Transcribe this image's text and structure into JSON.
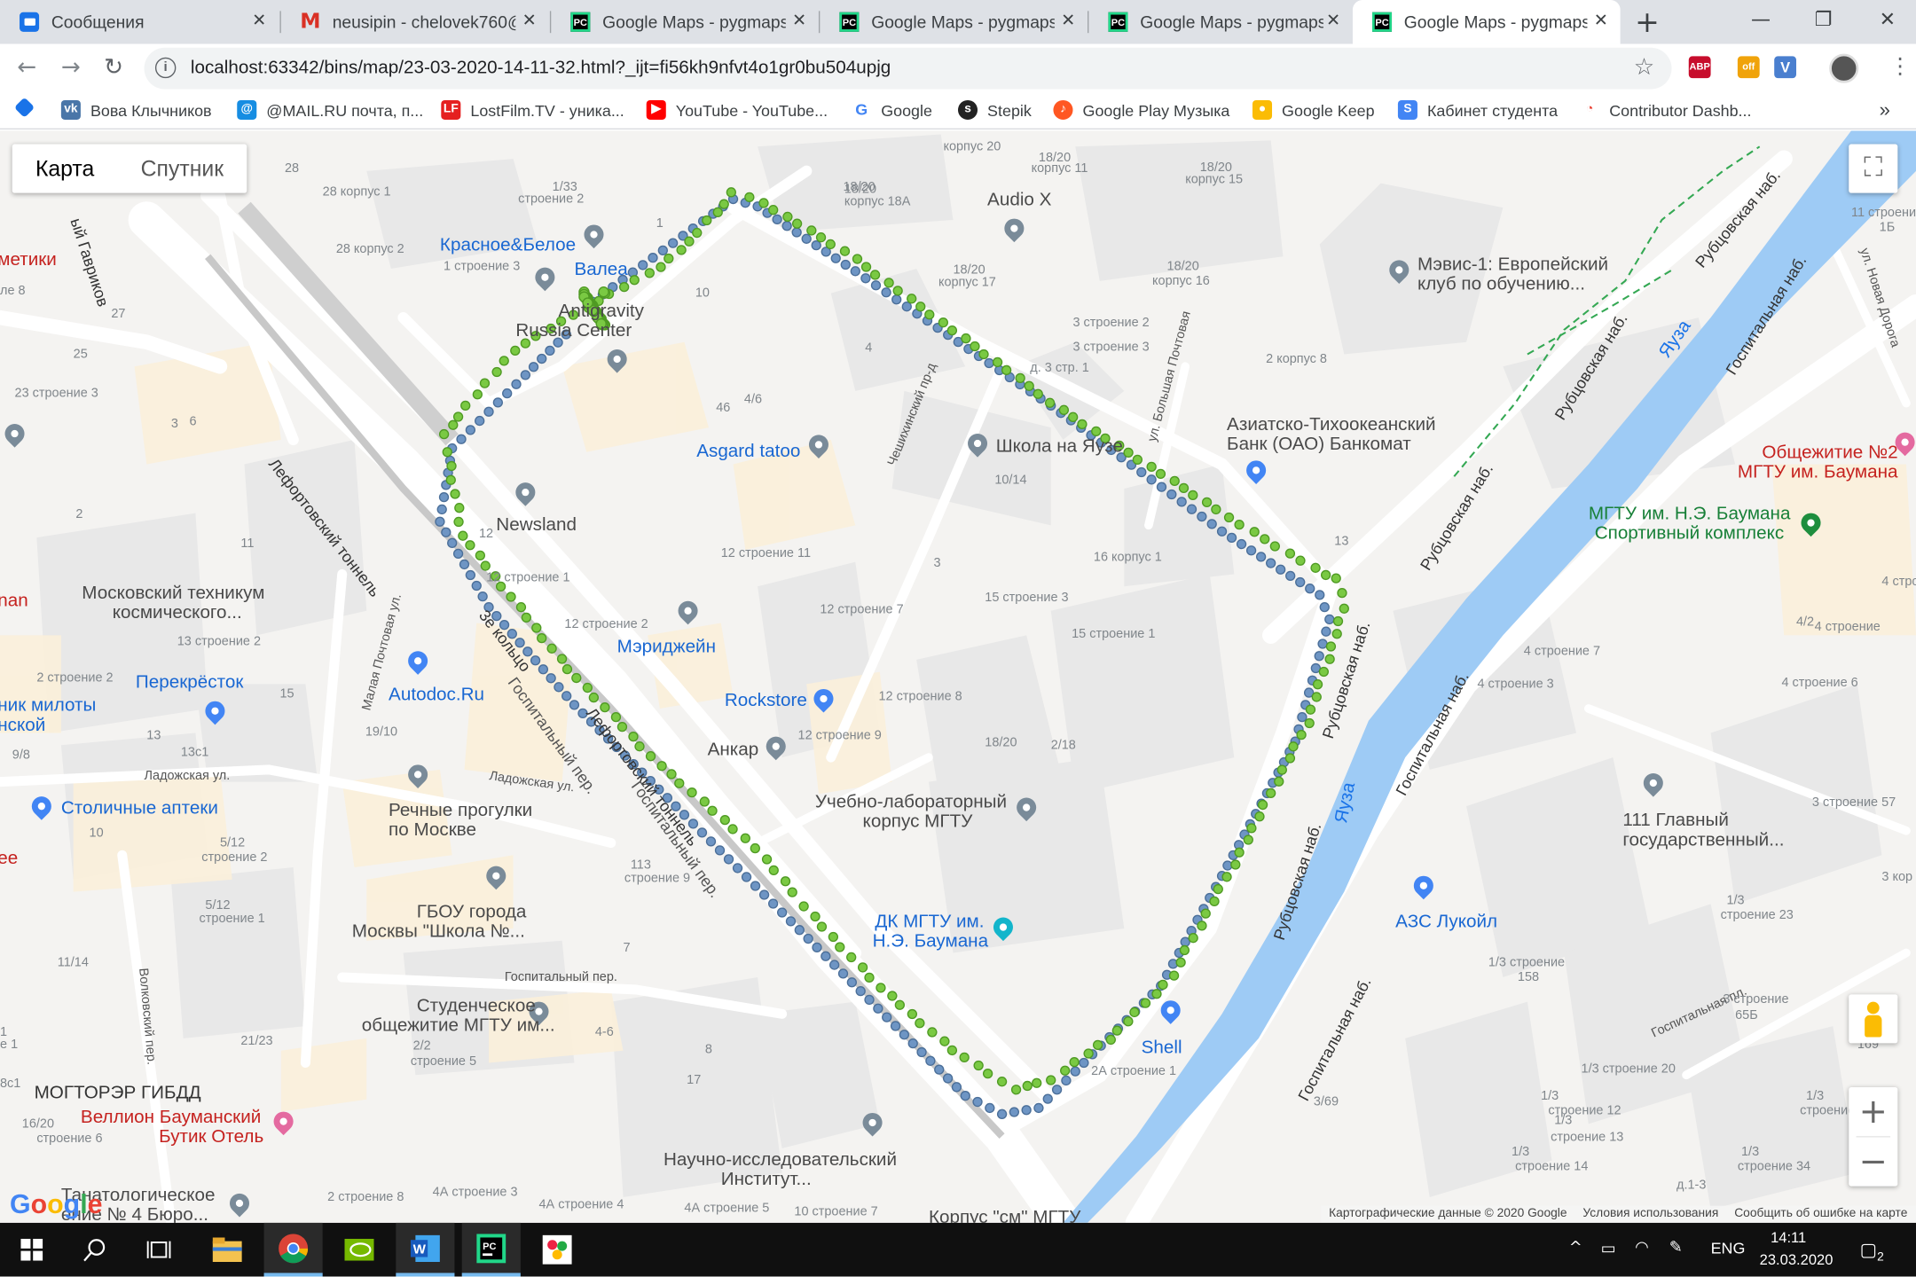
{
  "tabs": [
    {
      "title": "Сообщения",
      "icon": "messages-icon"
    },
    {
      "title": "neusipin - chelovek760@g",
      "icon": "gmail-icon"
    },
    {
      "title": "Google Maps - pygmaps",
      "icon": "pycharm-icon"
    },
    {
      "title": "Google Maps - pygmaps",
      "icon": "pycharm-icon"
    },
    {
      "title": "Google Maps - pygmaps",
      "icon": "pycharm-icon"
    },
    {
      "title": "Google Maps - pygmaps",
      "icon": "pycharm-icon",
      "active": true
    }
  ],
  "address_bar": {
    "url": "localhost:63342/bins/map/23-03-2020-14-11-32.html?_ijt=fi56kh9nfvt4o1gr0bu504upjg"
  },
  "extensions": [
    {
      "label": "ABP",
      "color": "#c70d2c"
    },
    {
      "label": "off",
      "color": "#f0a30a"
    },
    {
      "label": "V",
      "color": "#4a7fcf"
    }
  ],
  "bookmarks": [
    {
      "label": "",
      "icon": "diamond-icon"
    },
    {
      "label": "Вова Клычников",
      "icon": "vk-icon",
      "color": "#4a76a8"
    },
    {
      "label": "@MAIL.RU почта, п...",
      "icon": "mail-icon",
      "color": "#168de2"
    },
    {
      "label": "LostFilm.TV - уника...",
      "icon": "lostfilm-icon",
      "color": "#e52020"
    },
    {
      "label": "YouTube - YouTube...",
      "icon": "youtube-icon",
      "color": "#ff0000"
    },
    {
      "label": "Google",
      "icon": "google-icon",
      "color": "#4285f4"
    },
    {
      "label": "Stepik",
      "icon": "stepik-icon",
      "color": "#222"
    },
    {
      "label": "Google Play Музыка",
      "icon": "play-music-icon",
      "color": "#ff5722"
    },
    {
      "label": "Google Keep",
      "icon": "keep-icon",
      "color": "#fbbc04"
    },
    {
      "label": "Кабинет студента",
      "icon": "student-icon",
      "color": "#4285f4"
    },
    {
      "label": "Contributor Dashb...",
      "icon": "contributor-icon",
      "color": "#ea4335"
    }
  ],
  "map": {
    "map_type": [
      "Карта",
      "Спутник"
    ],
    "active_map_type": "Карта",
    "route_colors": {
      "recorded": "#7ac943",
      "reference": "#6e95c4"
    },
    "places": {
      "krasnoe": "Красное&Белое",
      "valea": "Валеа",
      "antigravity_1": "Antigravity",
      "antigravity_2": "Russia Center",
      "audio": "Audio X",
      "mavis_1": "Мэвис-1: Европейский",
      "mavis_2": "клуб по обучению...",
      "asgard": "Asgard tatoo",
      "school": "Школа на Яузе",
      "newsland": "Newsland",
      "bank_1": "Азиатско-Тихоокеанский",
      "bank_2": "Банк (ОАО) Банкомат",
      "dorm_1": "Общежитие №2",
      "dorm_2": "МГТУ им. Баумана",
      "sport_1": "МГТУ им. Н.Э. Баумана",
      "sport_2": "Спортивный комплекс",
      "technikum_1": "Московский техникум",
      "technikum_2": "космического...",
      "meridzhein": "Мэриджейн",
      "perekrestok": "Перекрёсток",
      "autodoc": "Autodoc.Ru",
      "rockstore": "Rockstore",
      "ankar": "Анкар",
      "ulk_1": "Учебно-лабораторный",
      "ulk_2": "корпус МГТУ",
      "milk_1": "ник милоты",
      "milk_2": "нской",
      "pharm": "Столичные аптеки",
      "river_1": "Речные прогулки",
      "river_2": "по Москве",
      "gbou_1": "ГБОУ города",
      "gbou_2": "Москвы \"Школа №...",
      "dk_1": "ДК МГТУ им.",
      "dk_2": "Н.Э. Баумана",
      "house_1": "111 Главный",
      "house_2": "государственный...",
      "azs": "АЗС Лукойл",
      "stud_1": "Студенческое",
      "stud_2": "общежитие МГТУ им...",
      "shell": "Shell",
      "gibdd": "МОГТОРЭР ГИБДД",
      "hotel_1": "Веллион Бауманский",
      "hotel_2": "Бутик Отель",
      "nii_1": "Научно-исследовательский",
      "nii_2": "Институт...",
      "thanat_1": "Танатологическое",
      "thanat_2": "ение № 4 Бюро...",
      "korpus_sm": "Корпус \"см\" МГТУ",
      "metiki": "метики",
      "nan": "nan",
      "ee": "ee"
    },
    "streets": {
      "lefortovo_tunnel_1": "Лефортовский тоннель",
      "lefortovo_tunnel_2": "Лефортовский тоннель",
      "ring": "3е кольцо",
      "gospital_per_1": "Госпитальный пер.",
      "gospital_per_2": "Госпитальный пер.",
      "gospital_per_3": "Госпитальный пер.",
      "ladozhskaya_1": "Ладожская ул.",
      "ladozhskaya_2": "Ладожская ул.",
      "malaya_pocht": "Малая Почтовая ул.",
      "bolshaya_pocht": "ул. Большая Почтовая",
      "cheshikhin": "Чешихинский пр-д",
      "rubtsovskaya_1": "Рубцовская наб.",
      "rubtsovskaya_2": "Рубцовская наб.",
      "rubtsovskaya_3": "Рубцовская наб.",
      "rubtsovskaya_4": "Рубцовская наб.",
      "rubtsovskaya_5": "Рубцовская наб.",
      "gospital_nab_1": "Госпитальная наб.",
      "gospital_nab_2": "Госпитальная наб.",
      "gospital_nab_3": "Госпитальная наб.",
      "gospital_nab_4": "Госпитальная наб.",
      "gospital_pl": "Госпитальная пл.",
      "volkovsky": "Волковский пер.",
      "novaya_doroga": "ул. Новая Дорога",
      "gavrikov": "ый Гавриков",
      "yauza_1": "Яуза",
      "yauza_2": "Яуза"
    },
    "addresses": [
      "28",
      "28 корпус 1",
      "28 корпус 2",
      "1/33",
      "строение 2",
      "1",
      "1 строение 3",
      "10",
      "18/20",
      "корпус 20",
      "18/20",
      "корпус 11",
      "18/20",
      "корпус 18А",
      "18/20",
      "корпус 15",
      "18/20",
      "корпус 17",
      "18/20",
      "корпус 16",
      "3 строение 2",
      "3 строение 3",
      "2 корпус 8",
      "д. 3 стр. 1",
      "4",
      "46",
      "4/6",
      "10/14",
      "3",
      "16 корпус 1",
      "15 строение 3",
      "15 строение 1",
      "13",
      "12 строение 1",
      "12 строение 2",
      "12 строение 7",
      "12 строение 11",
      "12 строение 8",
      "12 строение 9",
      "18/20",
      "2/18",
      "12",
      "11",
      "2",
      "6",
      "3",
      "27",
      "25",
      "23 строение 3",
      "ле 8",
      "13 строение 2",
      "2 строение 2",
      "15",
      "13",
      "13с1",
      "9/8",
      "19/10",
      "10",
      "5/12",
      "строение 2",
      "5/12",
      "строение 1",
      "113",
      "строение 9",
      "7",
      "11/14",
      "21/23",
      "2/2",
      "строение 5",
      "4-6",
      "8",
      "17",
      "16/20",
      "строение 6",
      "8с1",
      "4А строение 3",
      "2 строение 8",
      "4А строение 4",
      "4А строение 5",
      "10 строение 7",
      "2А строение 1",
      "3/69",
      "1/3 строение",
      "158",
      "1/3",
      "строение 23",
      "3 строение",
      "65Б",
      "1/3 строение 20",
      "1/3",
      "строение 12",
      "1/3",
      "строение 13",
      "1/3",
      "строение 62",
      "1/3",
      "строение 14",
      "1/3",
      "строение 34",
      "д.1-3",
      "169",
      "4 строение 7",
      "4 строение 3",
      "4 строение 6",
      "4/2",
      "4 строение",
      "4 строение",
      "3 строение 57",
      "3 кор",
      "11 строение",
      "1Б",
      "е 1",
      "1"
    ],
    "attribution": [
      "Картографические данные © 2020 Google",
      "Условия использования",
      "Сообщить об ошибке на карте"
    ]
  },
  "taskbar": {
    "lang": "ENG",
    "time": "14:11",
    "date": "23.03.2020",
    "notifications": "2"
  }
}
